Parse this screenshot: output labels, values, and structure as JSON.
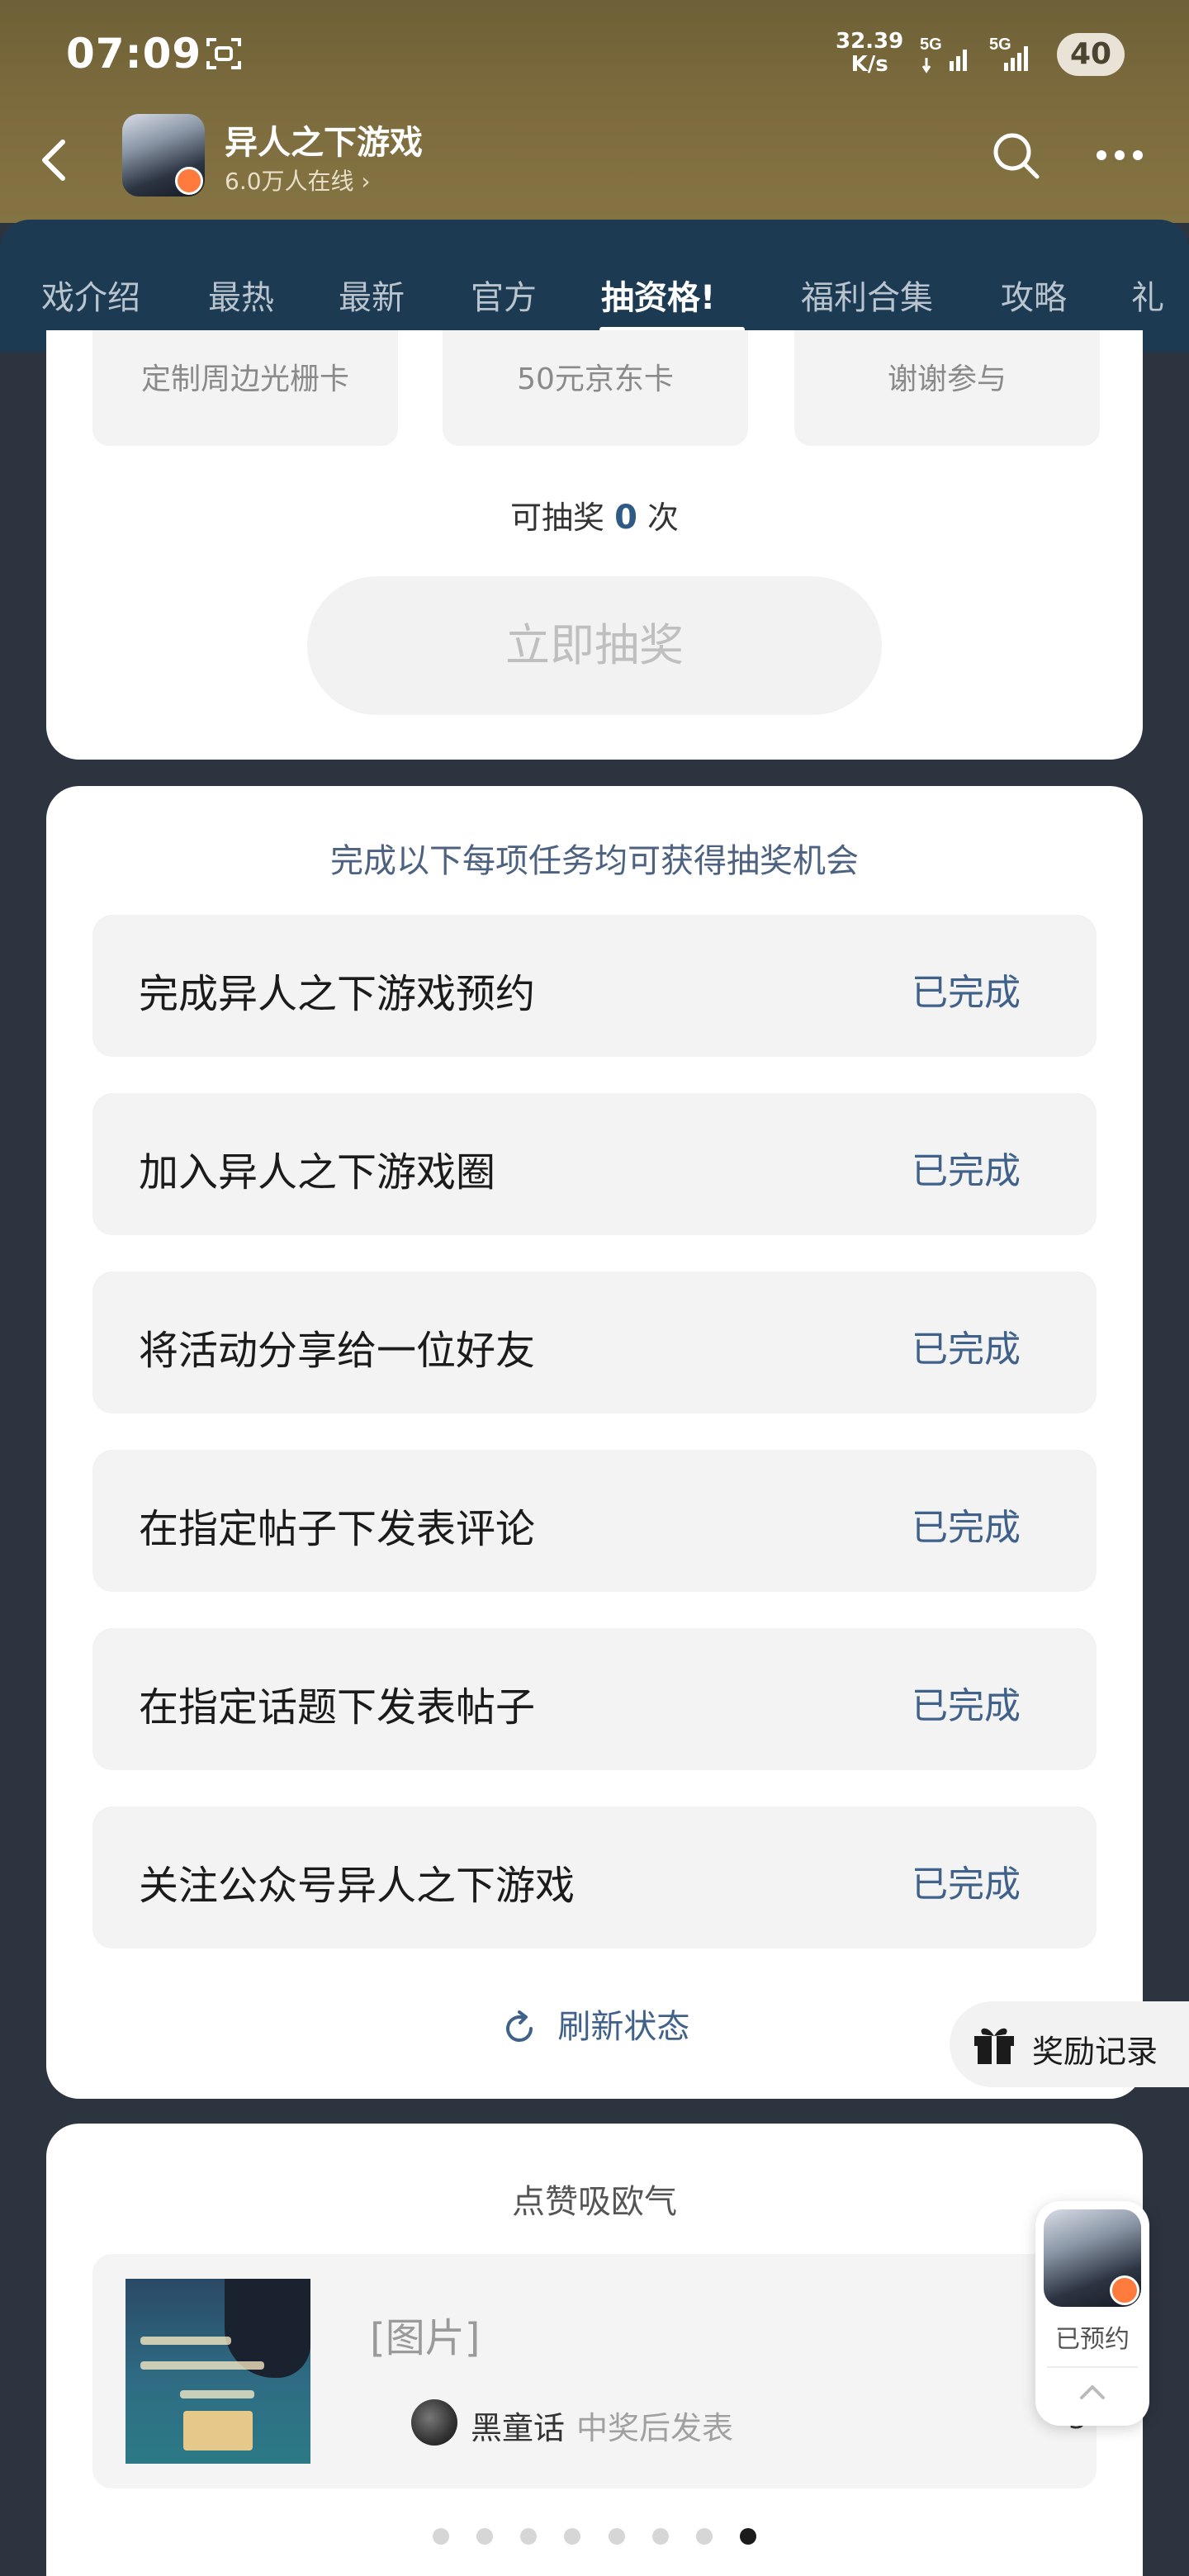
{
  "status_bar": {
    "time": "07:09",
    "net_speed_value": "32.39",
    "net_speed_unit": "K/s",
    "network1": "5G",
    "network2": "5G",
    "battery": "40"
  },
  "header": {
    "title": "异人之下游戏",
    "online": "6.0万人在线 ›"
  },
  "tabs": [
    {
      "label": "戏介绍"
    },
    {
      "label": "最热"
    },
    {
      "label": "最新"
    },
    {
      "label": "官方"
    },
    {
      "label": "抽资格!",
      "active": true
    },
    {
      "label": "福利合集"
    },
    {
      "label": "攻略"
    },
    {
      "label": "礼"
    }
  ],
  "lottery": {
    "prizes": [
      "定制周边光栅卡",
      "50元京东卡",
      "谢谢参与"
    ],
    "count_prefix": "可抽奖",
    "count_value": "0",
    "count_suffix": "次",
    "draw_button": "立即抽奖"
  },
  "tasks": {
    "title": "完成以下每项任务均可获得抽奖机会",
    "items": [
      {
        "name": "完成异人之下游戏预约",
        "state": "已完成"
      },
      {
        "name": "加入异人之下游戏圈",
        "state": "已完成"
      },
      {
        "name": "将活动分享给一位好友",
        "state": "已完成"
      },
      {
        "name": "在指定帖子下发表评论",
        "state": "已完成"
      },
      {
        "name": "在指定话题下发表帖子",
        "state": "已完成"
      },
      {
        "name": "关注公众号异人之下游戏",
        "state": "已完成"
      }
    ],
    "refresh": "刷新状态"
  },
  "reward_record": "奖励记录",
  "like_section": {
    "title": "点赞吸欧气",
    "post_text": "[图片]",
    "author": "黑童话",
    "after_text": "中奖后发表",
    "like_count": "3",
    "dots_total": 8,
    "dots_active": 7
  },
  "floating": {
    "reserved": "已预约"
  },
  "colors": {
    "accent_blue": "#40618a",
    "tab_bar": "#1c3a52",
    "header_bg": "#7c6b3d"
  }
}
